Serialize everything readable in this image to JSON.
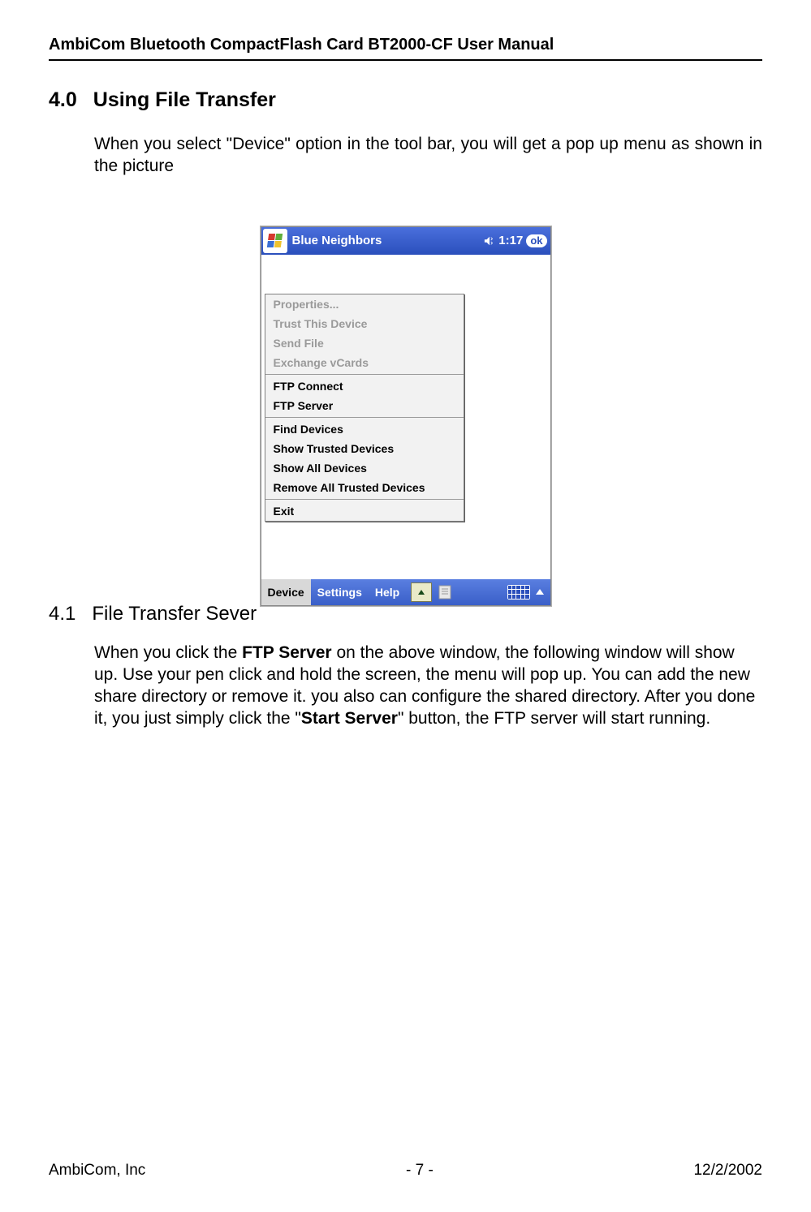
{
  "header": {
    "title": "AmbiCom Bluetooth CompactFlash Card BT2000-CF User Manual"
  },
  "section40": {
    "number": "4.0",
    "title": "Using File Transfer",
    "paragraph": "When you select \"Device\" option in the tool bar, you will get a pop up menu as shown in the picture"
  },
  "screenshot": {
    "titlebar": {
      "app_title": "Blue Neighbors",
      "time": "1:17",
      "ok_label": "ok"
    },
    "popup": {
      "group1": [
        "Properties...",
        "Trust This Device",
        "Send File",
        "Exchange vCards"
      ],
      "group2": [
        "FTP Connect",
        "FTP Server"
      ],
      "group3": [
        "Find Devices",
        "Show Trusted Devices",
        "Show All Devices",
        "Remove All Trusted Devices"
      ],
      "group4": [
        "Exit"
      ]
    },
    "bottombar": {
      "device": "Device",
      "settings": "Settings",
      "help": "Help"
    }
  },
  "section41": {
    "number": "4.1",
    "title": "File Transfer Sever",
    "p1_a": "When you click the ",
    "p1_bold1": "FTP Server",
    "p1_b": " on the above window, the following window will show up. Use your pen click and hold the screen, the menu will pop up. You can add the new share directory or remove it.  you also can configure the shared directory.  After you done it, you just simply click the \"",
    "p1_bold2": "Start Server",
    "p1_c": "\" button, the FTP server will start running."
  },
  "footer": {
    "left": "AmbiCom, Inc",
    "center": "- 7 -",
    "right": "12/2/2002"
  }
}
